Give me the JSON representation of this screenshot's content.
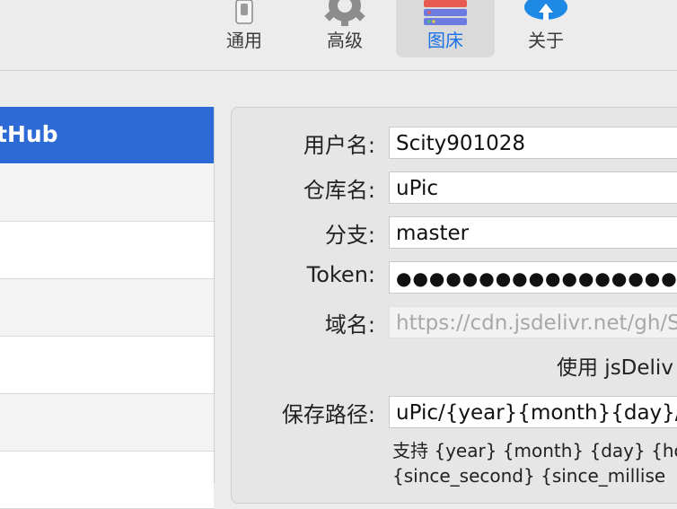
{
  "toolbar": {
    "tabs": [
      {
        "label": "通用",
        "icon": "switch-icon"
      },
      {
        "label": "高级",
        "icon": "gear-icon"
      },
      {
        "label": "图床",
        "icon": "server-icon",
        "selected": true
      },
      {
        "label": "关于",
        "icon": "cloud-upload-icon"
      }
    ]
  },
  "sidebar": {
    "items": [
      {
        "label": "tHub",
        "selected": true
      },
      {
        "label": ""
      },
      {
        "label": ""
      },
      {
        "label": ""
      },
      {
        "label": ""
      },
      {
        "label": ""
      },
      {
        "label": ""
      }
    ]
  },
  "form": {
    "username": {
      "label": "用户名:",
      "value": "Scity901028"
    },
    "repo": {
      "label": "仓库名:",
      "value": "uPic"
    },
    "branch": {
      "label": "分支:",
      "value": "master"
    },
    "token": {
      "label": "Token:",
      "value": "●●●●●●●●●●●●●●●●●●●●●●●●"
    },
    "domain": {
      "label": "域名:",
      "placeholder": "https://cdn.jsdelivr.net/gh/Sc"
    },
    "jsdelivr_checkbox_label": "使用 jsDeliv",
    "save_path": {
      "label": "保存路径:",
      "value": "uPic/{year}{month}{day}/{file"
    },
    "hint_line1": "支持 {year} {month} {day} {hou",
    "hint_line2": "{since_second} {since_millise"
  },
  "colors": {
    "accent": "#2d6ad5",
    "tab_selected_text": "#1a73e8"
  }
}
